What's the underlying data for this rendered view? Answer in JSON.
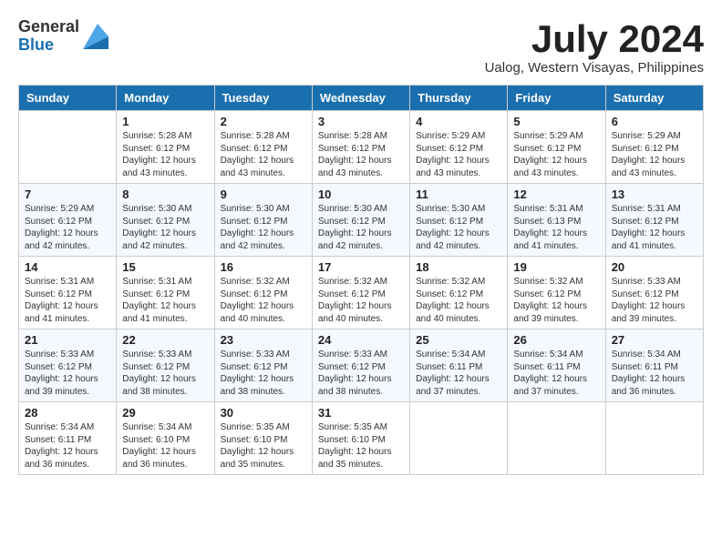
{
  "header": {
    "logo_general": "General",
    "logo_blue": "Blue",
    "month": "July 2024",
    "location": "Ualog, Western Visayas, Philippines"
  },
  "weekdays": [
    "Sunday",
    "Monday",
    "Tuesday",
    "Wednesday",
    "Thursday",
    "Friday",
    "Saturday"
  ],
  "weeks": [
    [
      {
        "day": "",
        "info": ""
      },
      {
        "day": "1",
        "info": "Sunrise: 5:28 AM\nSunset: 6:12 PM\nDaylight: 12 hours\nand 43 minutes."
      },
      {
        "day": "2",
        "info": "Sunrise: 5:28 AM\nSunset: 6:12 PM\nDaylight: 12 hours\nand 43 minutes."
      },
      {
        "day": "3",
        "info": "Sunrise: 5:28 AM\nSunset: 6:12 PM\nDaylight: 12 hours\nand 43 minutes."
      },
      {
        "day": "4",
        "info": "Sunrise: 5:29 AM\nSunset: 6:12 PM\nDaylight: 12 hours\nand 43 minutes."
      },
      {
        "day": "5",
        "info": "Sunrise: 5:29 AM\nSunset: 6:12 PM\nDaylight: 12 hours\nand 43 minutes."
      },
      {
        "day": "6",
        "info": "Sunrise: 5:29 AM\nSunset: 6:12 PM\nDaylight: 12 hours\nand 43 minutes."
      }
    ],
    [
      {
        "day": "7",
        "info": "Sunrise: 5:29 AM\nSunset: 6:12 PM\nDaylight: 12 hours\nand 42 minutes."
      },
      {
        "day": "8",
        "info": "Sunrise: 5:30 AM\nSunset: 6:12 PM\nDaylight: 12 hours\nand 42 minutes."
      },
      {
        "day": "9",
        "info": "Sunrise: 5:30 AM\nSunset: 6:12 PM\nDaylight: 12 hours\nand 42 minutes."
      },
      {
        "day": "10",
        "info": "Sunrise: 5:30 AM\nSunset: 6:12 PM\nDaylight: 12 hours\nand 42 minutes."
      },
      {
        "day": "11",
        "info": "Sunrise: 5:30 AM\nSunset: 6:12 PM\nDaylight: 12 hours\nand 42 minutes."
      },
      {
        "day": "12",
        "info": "Sunrise: 5:31 AM\nSunset: 6:13 PM\nDaylight: 12 hours\nand 41 minutes."
      },
      {
        "day": "13",
        "info": "Sunrise: 5:31 AM\nSunset: 6:12 PM\nDaylight: 12 hours\nand 41 minutes."
      }
    ],
    [
      {
        "day": "14",
        "info": "Sunrise: 5:31 AM\nSunset: 6:12 PM\nDaylight: 12 hours\nand 41 minutes."
      },
      {
        "day": "15",
        "info": "Sunrise: 5:31 AM\nSunset: 6:12 PM\nDaylight: 12 hours\nand 41 minutes."
      },
      {
        "day": "16",
        "info": "Sunrise: 5:32 AM\nSunset: 6:12 PM\nDaylight: 12 hours\nand 40 minutes."
      },
      {
        "day": "17",
        "info": "Sunrise: 5:32 AM\nSunset: 6:12 PM\nDaylight: 12 hours\nand 40 minutes."
      },
      {
        "day": "18",
        "info": "Sunrise: 5:32 AM\nSunset: 6:12 PM\nDaylight: 12 hours\nand 40 minutes."
      },
      {
        "day": "19",
        "info": "Sunrise: 5:32 AM\nSunset: 6:12 PM\nDaylight: 12 hours\nand 39 minutes."
      },
      {
        "day": "20",
        "info": "Sunrise: 5:33 AM\nSunset: 6:12 PM\nDaylight: 12 hours\nand 39 minutes."
      }
    ],
    [
      {
        "day": "21",
        "info": "Sunrise: 5:33 AM\nSunset: 6:12 PM\nDaylight: 12 hours\nand 39 minutes."
      },
      {
        "day": "22",
        "info": "Sunrise: 5:33 AM\nSunset: 6:12 PM\nDaylight: 12 hours\nand 38 minutes."
      },
      {
        "day": "23",
        "info": "Sunrise: 5:33 AM\nSunset: 6:12 PM\nDaylight: 12 hours\nand 38 minutes."
      },
      {
        "day": "24",
        "info": "Sunrise: 5:33 AM\nSunset: 6:12 PM\nDaylight: 12 hours\nand 38 minutes."
      },
      {
        "day": "25",
        "info": "Sunrise: 5:34 AM\nSunset: 6:11 PM\nDaylight: 12 hours\nand 37 minutes."
      },
      {
        "day": "26",
        "info": "Sunrise: 5:34 AM\nSunset: 6:11 PM\nDaylight: 12 hours\nand 37 minutes."
      },
      {
        "day": "27",
        "info": "Sunrise: 5:34 AM\nSunset: 6:11 PM\nDaylight: 12 hours\nand 36 minutes."
      }
    ],
    [
      {
        "day": "28",
        "info": "Sunrise: 5:34 AM\nSunset: 6:11 PM\nDaylight: 12 hours\nand 36 minutes."
      },
      {
        "day": "29",
        "info": "Sunrise: 5:34 AM\nSunset: 6:10 PM\nDaylight: 12 hours\nand 36 minutes."
      },
      {
        "day": "30",
        "info": "Sunrise: 5:35 AM\nSunset: 6:10 PM\nDaylight: 12 hours\nand 35 minutes."
      },
      {
        "day": "31",
        "info": "Sunrise: 5:35 AM\nSunset: 6:10 PM\nDaylight: 12 hours\nand 35 minutes."
      },
      {
        "day": "",
        "info": ""
      },
      {
        "day": "",
        "info": ""
      },
      {
        "day": "",
        "info": ""
      }
    ]
  ]
}
